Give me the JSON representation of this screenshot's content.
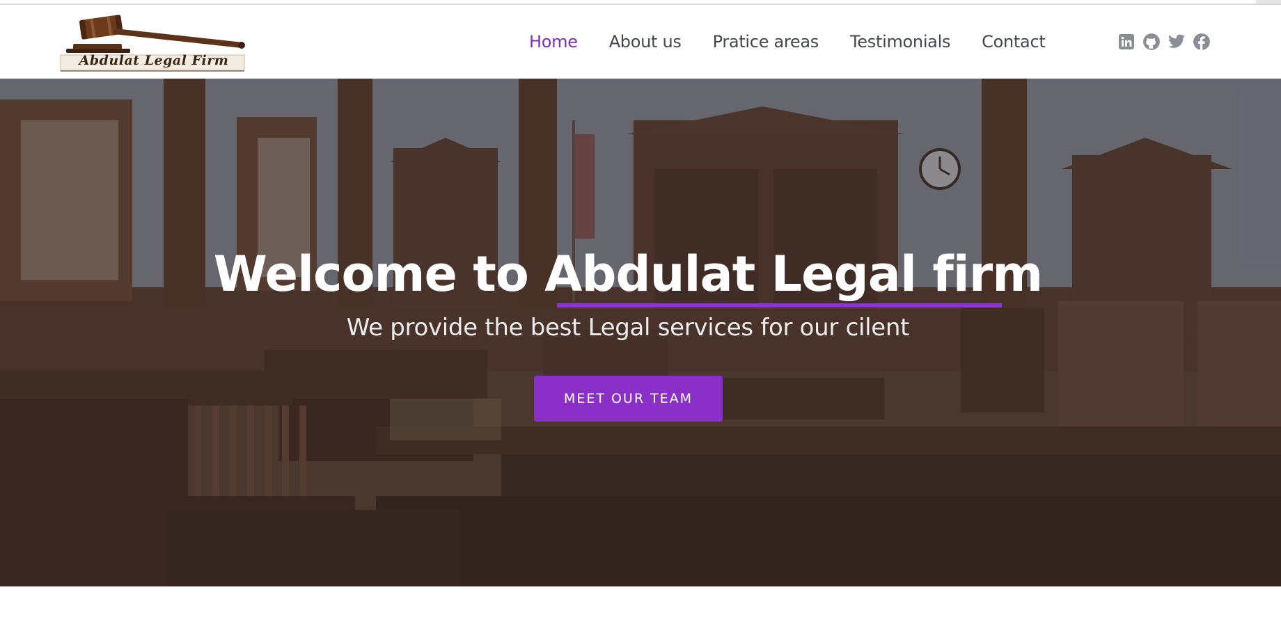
{
  "brand": {
    "logo_text": "Abdulat Legal Firm",
    "accent_color": "#8a2fc8",
    "active_nav_color": "#7c2fbf",
    "nav_text_color": "#444650",
    "icon_color": "#8b8d94"
  },
  "nav": {
    "items": [
      {
        "label": "Home",
        "active": true
      },
      {
        "label": "About us",
        "active": false
      },
      {
        "label": "Pratice areas",
        "active": false
      },
      {
        "label": "Testimonials",
        "active": false
      },
      {
        "label": "Contact",
        "active": false
      }
    ],
    "social": [
      "linkedin-icon",
      "github-icon",
      "twitter-icon",
      "facebook-icon"
    ]
  },
  "hero": {
    "title": "Welcome to Abdulat Legal firm",
    "subtitle": "We provide the best Legal services for our cilent",
    "button_label": "MEET OUR TEAM",
    "background": "courtroom-photo"
  }
}
